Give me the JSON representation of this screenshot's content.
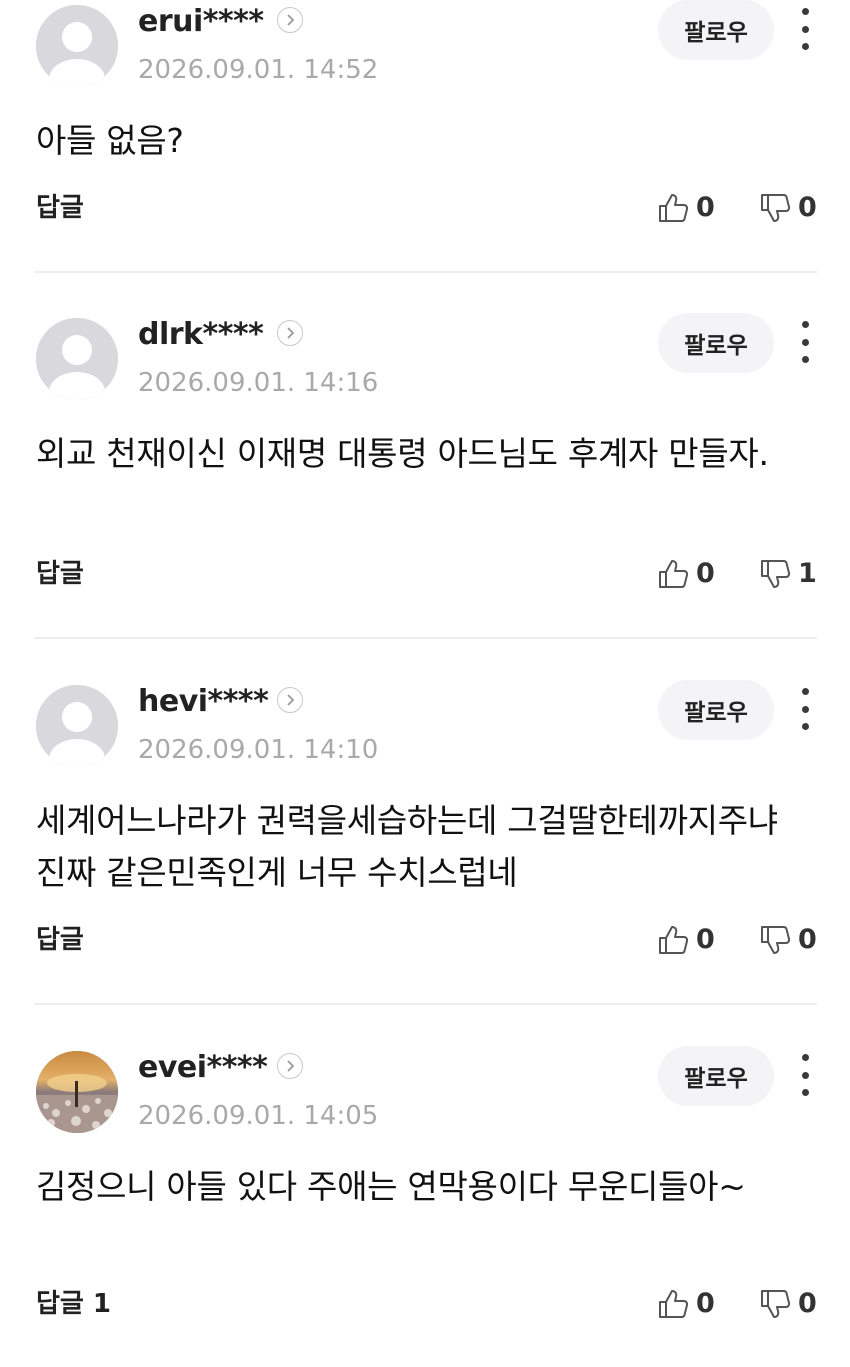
{
  "comments": [
    {
      "username": "erui****",
      "timestamp": "2026.09.01. 14:52",
      "follow_label": "팔로우",
      "text": "아들 없음?",
      "reply_label": "답글",
      "likes": "0",
      "dislikes": "0",
      "avatar": "default-avatar-icon"
    },
    {
      "username": "dlrk****",
      "timestamp": "2026.09.01. 14:16",
      "follow_label": "팔로우",
      "text": "외교 천재이신 이재명 대통령 아드님도 후계자 만들자.",
      "reply_label": "답글",
      "likes": "0",
      "dislikes": "1",
      "avatar": "default-avatar-icon"
    },
    {
      "username": "hevi****",
      "timestamp": "2026.09.01. 14:10",
      "follow_label": "팔로우",
      "text": "세계어느나라가 권력을세습하는데 그걸딸한테까지주냐 진짜 같은민족인게 너무 수치스럽네",
      "reply_label": "답글",
      "likes": "0",
      "dislikes": "0",
      "avatar": "default-avatar-icon"
    },
    {
      "username": "evei****",
      "timestamp": "2026.09.01. 14:05",
      "follow_label": "팔로우",
      "text": "김정으니 아들 있다 주애는 연막용이다 무운디들아~",
      "reply_label": "답글 1",
      "likes": "0",
      "dislikes": "0",
      "avatar": "photo-avatar"
    }
  ]
}
